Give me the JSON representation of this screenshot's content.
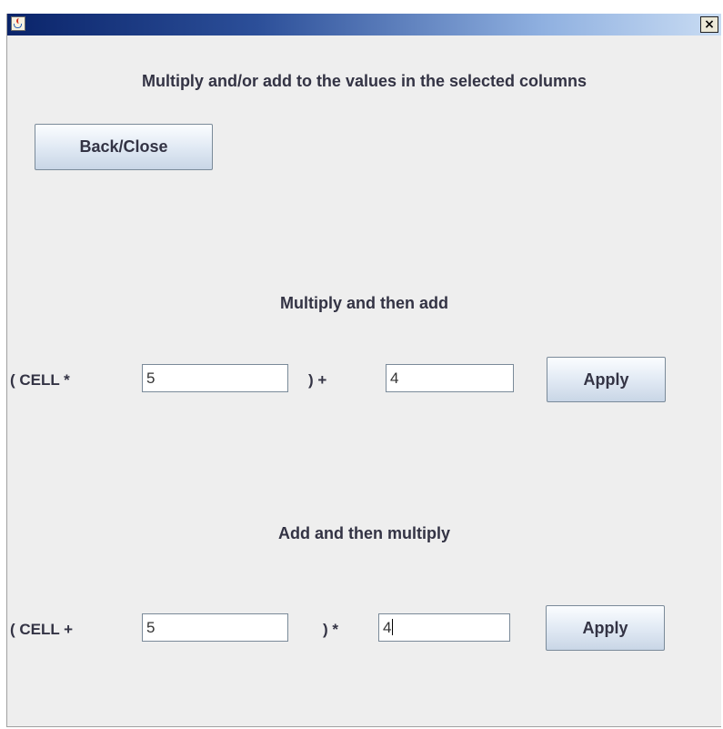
{
  "titlebar": {
    "icon": "java-cup-icon",
    "close_label": "×"
  },
  "dialog": {
    "heading": "Multiply and/or add to the values in the selected columns",
    "back_close_label": "Back/Close"
  },
  "multiply_then_add": {
    "title": "Multiply and then add",
    "prefix_label": "( CELL *",
    "operator_label": ") +",
    "multiplier_value": "5",
    "addend_value": "4",
    "apply_label": "Apply"
  },
  "add_then_multiply": {
    "title": "Add and then multiply",
    "prefix_label": "( CELL +",
    "operator_label": ") *",
    "addend_value": "5",
    "multiplier_value": "4",
    "apply_label": "Apply"
  }
}
